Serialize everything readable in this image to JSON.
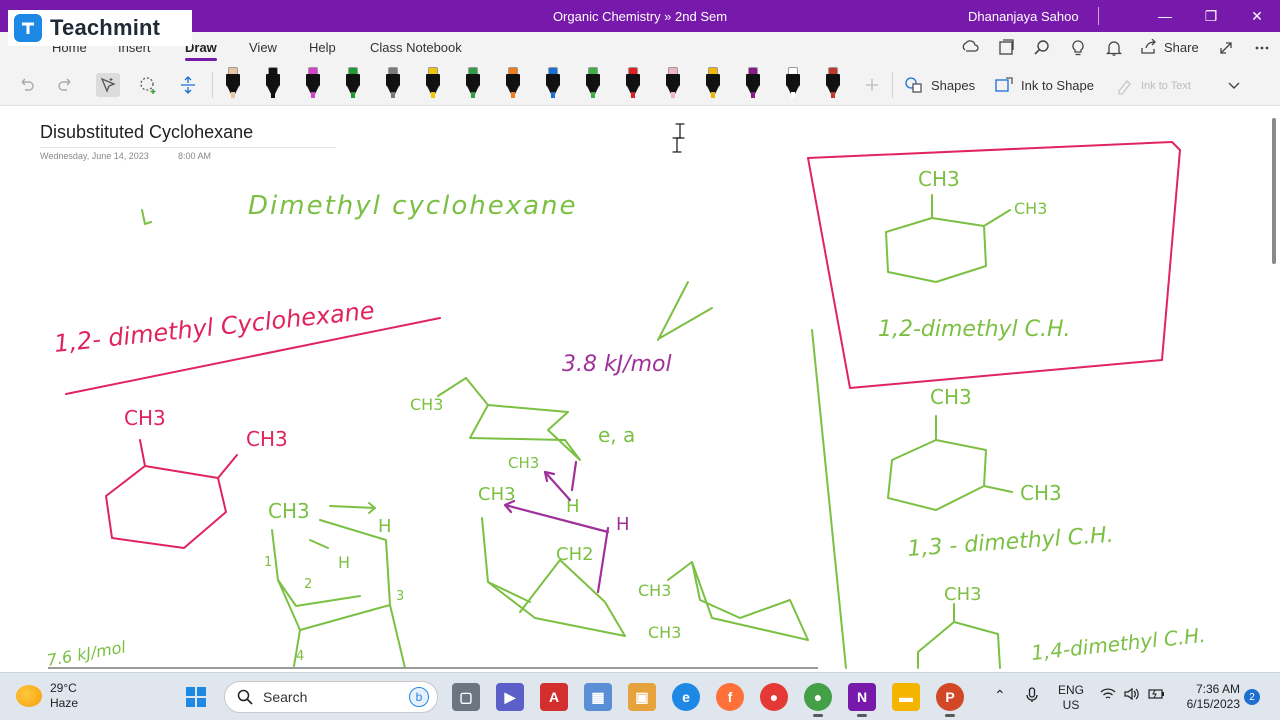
{
  "window": {
    "title": "Organic Chemistry » 2nd Sem",
    "user": "Dhananjaya Sahoo",
    "controls": [
      "—",
      "❐",
      "✕"
    ]
  },
  "ribbon": {
    "tabs": [
      "Home",
      "Insert",
      "Draw",
      "View",
      "Help",
      "Class Notebook"
    ],
    "active_tab": "Draw",
    "share_label": "Share",
    "right_icons": [
      "sync-icon",
      "page-icon",
      "search-icon",
      "lightbulb-icon",
      "bell-icon",
      "share-icon",
      "expand-icon",
      "more-icon"
    ]
  },
  "toolbar": {
    "pen_colors": [
      "#e8c7a0",
      "#111111",
      "#d63fcf",
      "#1a9e2f",
      "#7a7a7a",
      "#f5c400",
      "#2ea043",
      "#f07d1a",
      "#1a6fd6",
      "#3cb043",
      "#e02020",
      "#f0b6c0",
      "#f2b705",
      "#8a1a8a",
      "#ffffff",
      "#c0392b"
    ],
    "shapes_label": "Shapes",
    "ink_to_shape_label": "Ink to Shape",
    "ink_to_text_label": "Ink to Text"
  },
  "page": {
    "title": "Disubstituted Cyclohexane",
    "date": "Wednesday, June 14, 2023",
    "time": "8:00 AM"
  },
  "ink": {
    "heading_green": "Dimethyl cyclohexane",
    "red_heading": "1,2- dimethyl Cyclohexane",
    "energy_purple": "3.8 kJ/mol",
    "label_ea": "e, a",
    "bottom_energy": "7.6 kJ/mol",
    "ch3": "CH3",
    "h": "H",
    "box_caption": "1,2-dimethyl C.H.",
    "caption_13": "1,3 - dimethyl C.H.",
    "caption_14": "1,4-dimethyl C.H.",
    "ring_numbers": [
      "1",
      "2",
      "3",
      "4"
    ]
  },
  "taskbar": {
    "temperature": "29°C",
    "condition": "Haze",
    "search_placeholder": "Search",
    "language": "ENG",
    "region": "US",
    "time": "7:36 AM",
    "date": "6/15/2023",
    "notifications": "2"
  },
  "overlay": {
    "brand": "Teachmint"
  }
}
